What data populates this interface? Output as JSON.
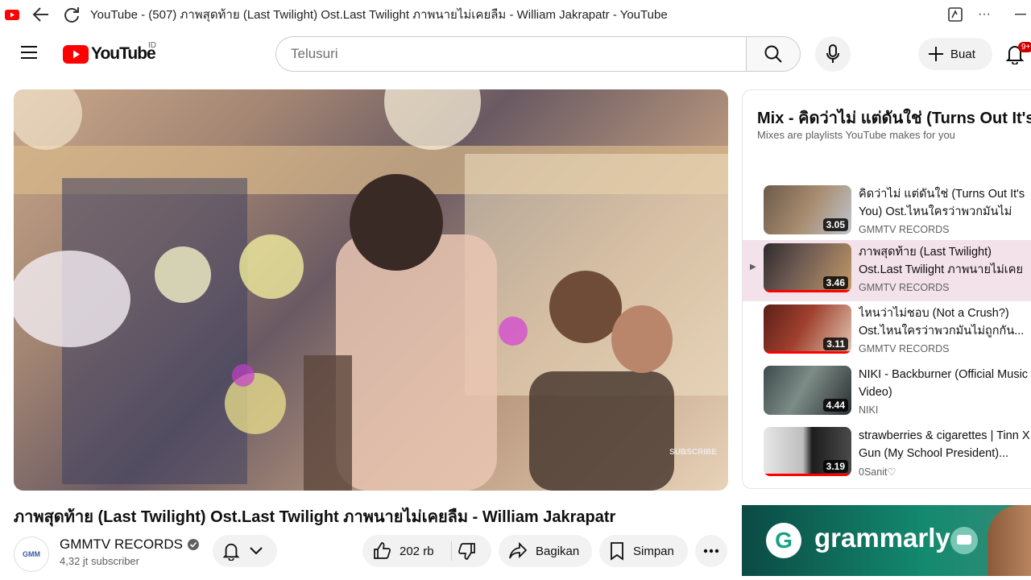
{
  "browser": {
    "title": "YouTube - (507) ภาพสุดท้าย (Last Twilight) Ost.Last Twilight ภาพนายไม่เคยลืม - William Jakrapatr - YouTube"
  },
  "masthead": {
    "logo_text": "YouTube",
    "region": "ID",
    "search_placeholder": "Telusuri",
    "create_label": "Buat",
    "notif_count": "9+"
  },
  "video": {
    "title": "ภาพสุดท้าย (Last Twilight) Ost.Last Twilight ภาพนายไม่เคยลืม - William Jakrapatr",
    "watermark": "SUBSCRIBE",
    "channel_name": "GMMTV RECORDS",
    "channel_avatar_text": "GMM",
    "subscribers": "4,32 jt subscriber",
    "likes": "202 rb",
    "share_label": "Bagikan",
    "save_label": "Simpan"
  },
  "playlist": {
    "title": "Mix - คิดว่าไม่ แต่ดันใช่ (Turns Out It's You)",
    "subtitle": "Mixes are playlists YouTube makes for you",
    "items": [
      {
        "title": "คิดว่าไม่ แต่ดันใช่ (Turns Out It's You) Ost.ไหนใครว่าพวกมันไม่ถูกกัน...",
        "channel": "GMMTV RECORDS",
        "duration": "3.05",
        "active": false
      },
      {
        "title": "ภาพสุดท้าย (Last Twilight) Ost.Last Twilight ภาพนายไม่เคยลืม...",
        "channel": "GMMTV RECORDS",
        "duration": "3.46",
        "active": true
      },
      {
        "title": "ไหนว่าไม่ชอบ (Not a Crush?) Ost.ไหนใครว่าพวกมันไม่ถูกกัน...",
        "channel": "GMMTV RECORDS",
        "duration": "3.11",
        "active": false
      },
      {
        "title": "NIKI - Backburner (Official Music Video)",
        "channel": "NIKI",
        "duration": "4.44",
        "active": false
      },
      {
        "title": "strawberries & cigarettes | Tinn X Gun (My School President)...",
        "channel": "0Sanit♡",
        "duration": "3.19",
        "active": false
      }
    ]
  },
  "ad": {
    "brand": "grammarly",
    "logo_letter": "G"
  },
  "colors": {
    "youtube_red": "#ff0000",
    "active_item_bg": "#f3e2ea"
  }
}
